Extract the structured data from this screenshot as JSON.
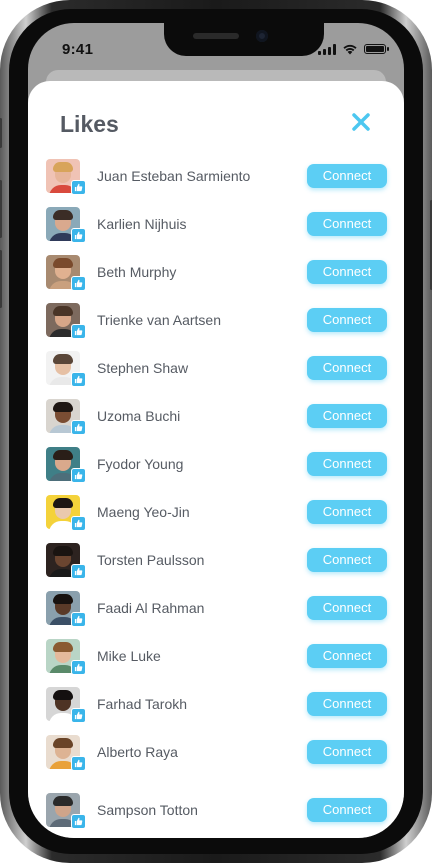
{
  "status_bar": {
    "time": "9:41"
  },
  "header": {
    "title": "Likes",
    "close_icon": "close-icon"
  },
  "colors": {
    "accent": "#5ccef4",
    "like_badge": "#3ab5ea",
    "title_text": "#555a63"
  },
  "users": [
    {
      "name": "Juan Esteban Sarmiento",
      "action": "Connect",
      "skin": "#e7b59a",
      "hair": "#d8a45a",
      "shirt": "#d94a3d",
      "bg": "#f0c3b5"
    },
    {
      "name": "Karlien Nijhuis",
      "action": "Connect",
      "skin": "#d9a98e",
      "hair": "#3b2d26",
      "shirt": "#2f3a5a",
      "bg": "#8aa9b8"
    },
    {
      "name": "Beth Murphy",
      "action": "Connect",
      "skin": "#e0b190",
      "hair": "#7a4a2c",
      "shirt": "#c9a07e",
      "bg": "#a88a70"
    },
    {
      "name": "Trienke van Aartsen",
      "action": "Connect",
      "skin": "#d7a688",
      "hair": "#4a3527",
      "shirt": "#2c2c2c",
      "bg": "#7d6a5e"
    },
    {
      "name": "Stephen Shaw",
      "action": "Connect",
      "skin": "#e6c0a4",
      "hair": "#5a4638",
      "shirt": "#e9e9e9",
      "bg": "#f2f2f2"
    },
    {
      "name": "Uzoma Buchi",
      "action": "Connect",
      "skin": "#7a4d33",
      "hair": "#1e1612",
      "shirt": "#b8c8d4",
      "bg": "#d9d5cf"
    },
    {
      "name": "Fyodor Young",
      "action": "Connect",
      "skin": "#d9a98c",
      "hair": "#2a1e18",
      "shirt": "#4d6e7a",
      "bg": "#3f7f87"
    },
    {
      "name": "Maeng Yeo-Jin",
      "action": "Connect",
      "skin": "#eac9ae",
      "hair": "#1d1614",
      "shirt": "#ffffff",
      "bg": "#f4d23a"
    },
    {
      "name": "Torsten Paulsson",
      "action": "Connect",
      "skin": "#6b4530",
      "hair": "#1a1411",
      "shirt": "#1a1a1a",
      "bg": "#2d2320"
    },
    {
      "name": "Faadi Al Rahman",
      "action": "Connect",
      "skin": "#5a3a28",
      "hair": "#18120f",
      "shirt": "#3b4f66",
      "bg": "#8aa0ad"
    },
    {
      "name": "Mike Luke",
      "action": "Connect",
      "skin": "#e4b99c",
      "hair": "#8a5a32",
      "shirt": "#5a8a6a",
      "bg": "#b9d5c6"
    },
    {
      "name": "Farhad Tarokh",
      "action": "Connect",
      "skin": "#4e3324",
      "hair": "#141010",
      "shirt": "#ffffff",
      "bg": "#d6d6d6"
    },
    {
      "name": "Alberto Raya",
      "action": "Connect",
      "skin": "#ddb393",
      "hair": "#6a4428",
      "shirt": "#e9a13a",
      "bg": "#e9dccf"
    },
    {
      "name": "Sampson Totton",
      "action": "Connect",
      "skin": "#cfa48a",
      "hair": "#2a2a2a",
      "shirt": "#5e6b78",
      "bg": "#9aa5ad"
    }
  ]
}
